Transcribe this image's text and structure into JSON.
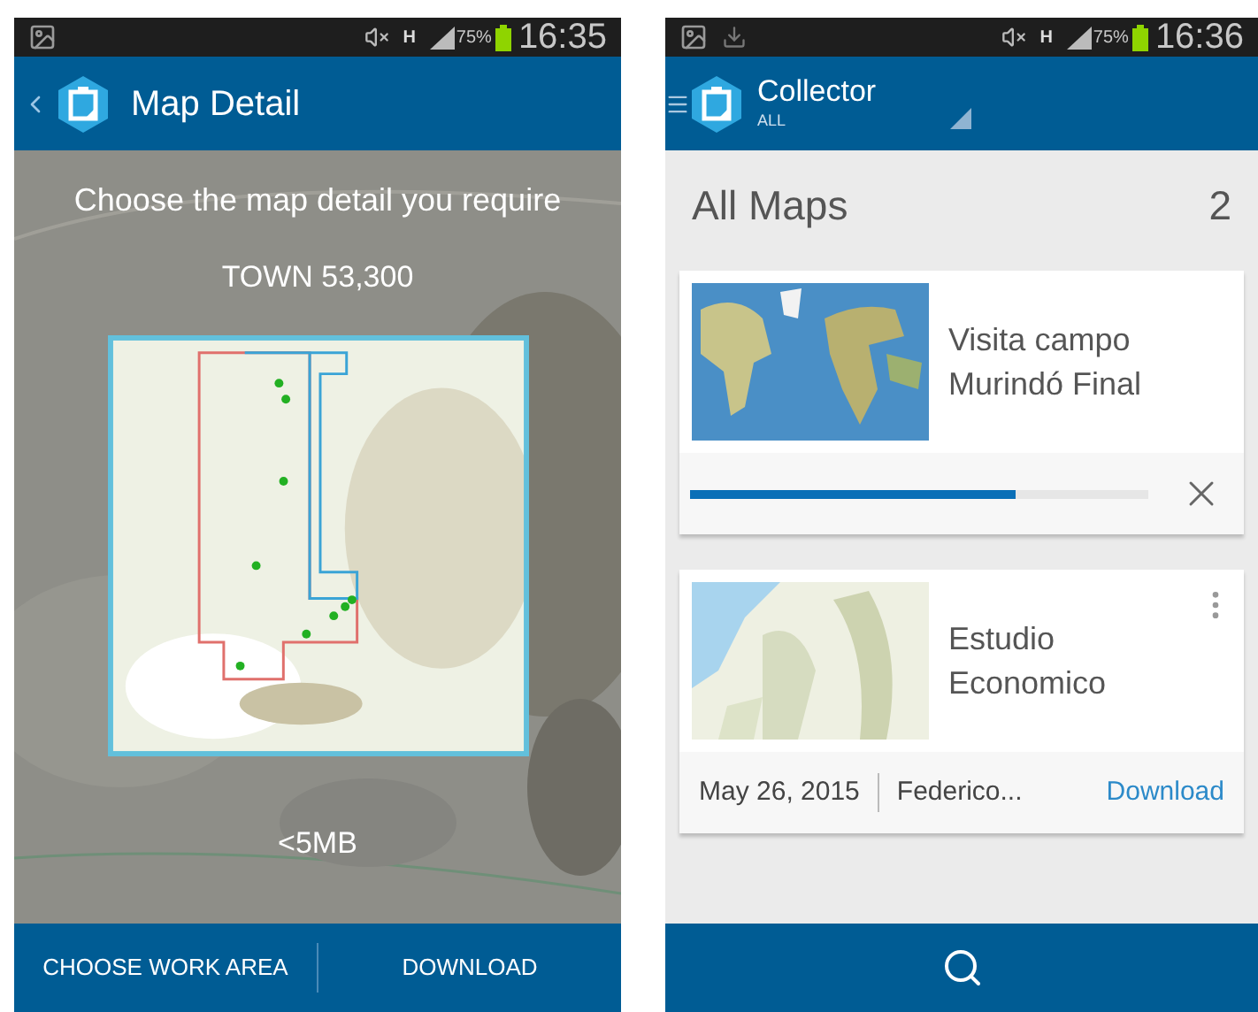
{
  "screens": [
    {
      "kind": "detail",
      "status_bar": {
        "download": false,
        "network_type": "H",
        "battery_percent": "75%",
        "time": "16:35"
      },
      "app_bar": {
        "title": "Map Detail",
        "back": true
      },
      "prompt": "Choose the map detail you require",
      "detail_level": "TOWN 53,300",
      "size": "<5MB",
      "bottom_bar": [
        {
          "kind": "text",
          "label": "CHOOSE WORK AREA"
        },
        {
          "kind": "text",
          "label": "DOWNLOAD"
        }
      ]
    },
    {
      "kind": "list",
      "status_bar": {
        "download": true,
        "network_type": "H",
        "battery_percent": "75%",
        "time": "16:36"
      },
      "app_bar": {
        "title": "Collector",
        "subtitle": "ALL",
        "back": false
      },
      "heading": "All Maps",
      "count": "2",
      "maps": [
        {
          "kind": "downloading",
          "title": "Visita campo Murindó Final",
          "level": 0.71
        },
        {
          "kind": "available",
          "title": "Estudio Economico",
          "date": "May 26, 2015",
          "owner": "Federico...",
          "action": "Download"
        }
      ],
      "bottom_bar": [
        {
          "kind": "search"
        }
      ]
    }
  ]
}
